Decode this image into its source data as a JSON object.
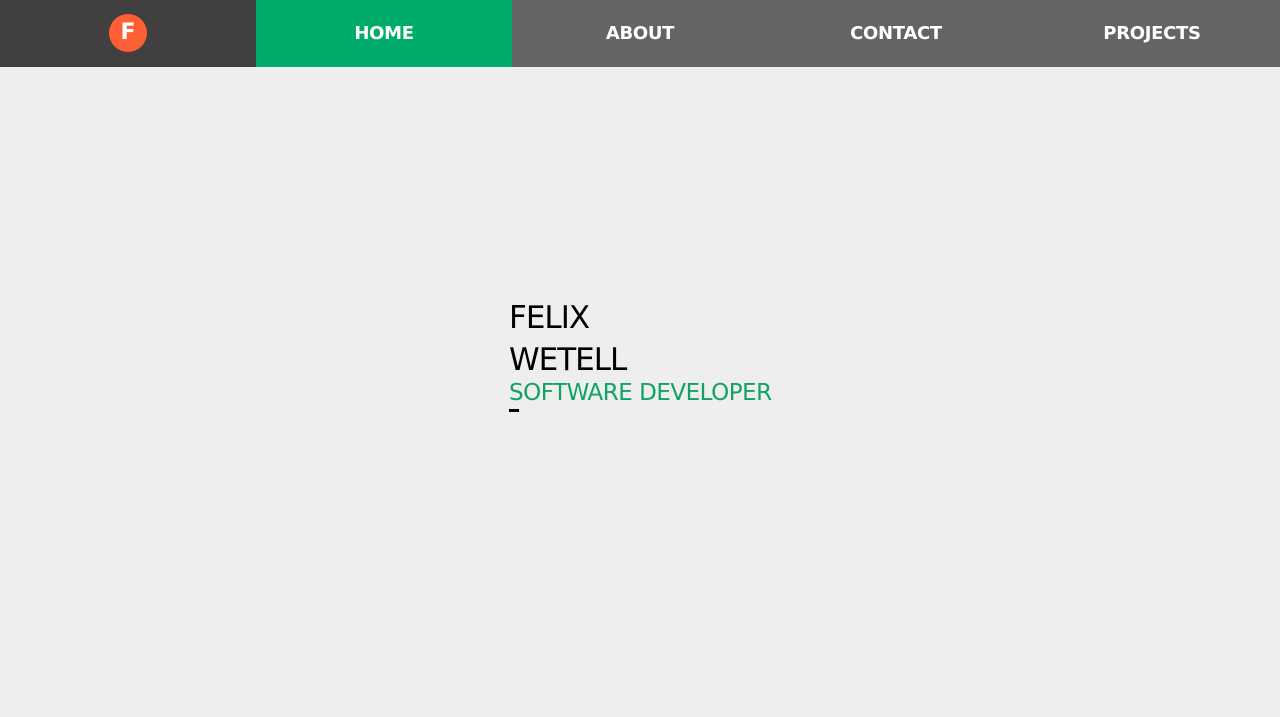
{
  "logo": {
    "letter": "F",
    "color": "#ff5f34"
  },
  "nav": {
    "items": [
      {
        "label": "HOME",
        "active": true
      },
      {
        "label": "ABOUT",
        "active": false
      },
      {
        "label": "CONTACT",
        "active": false
      },
      {
        "label": "PROJECTS",
        "active": false
      }
    ],
    "accent_color": "#00ac6a",
    "bar_color": "#646464",
    "logo_cell_color": "#404040"
  },
  "hero": {
    "first_name": "FELIX",
    "last_name": "WETELL",
    "role": "SOFTWARE DEVELOPER",
    "role_color": "#11a266"
  },
  "page": {
    "background": "#eeeeee"
  }
}
